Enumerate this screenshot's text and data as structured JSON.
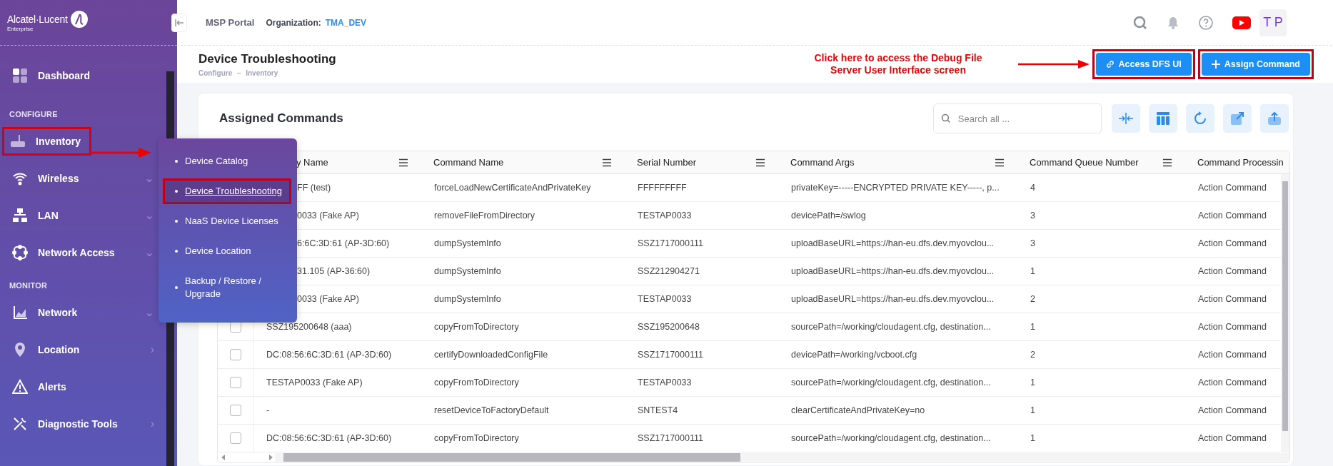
{
  "sidebar": {
    "brand": "Alcatel·Lucent",
    "brand_sub": "Enterprise",
    "items": [
      {
        "kind": "item",
        "label": "Dashboard",
        "highlighted": false
      },
      {
        "kind": "section",
        "label": "CONFIGURE"
      },
      {
        "kind": "item",
        "label": "Inventory",
        "highlighted": true
      },
      {
        "kind": "item",
        "label": "Wireless",
        "highlighted": false,
        "chevron": "⌄"
      },
      {
        "kind": "item",
        "label": "LAN",
        "highlighted": false,
        "chevron": "⌄"
      },
      {
        "kind": "item",
        "label": "Network Access",
        "highlighted": false,
        "chevron": "⌄"
      },
      {
        "kind": "section",
        "label": "MONITOR"
      },
      {
        "kind": "item",
        "label": "Network",
        "highlighted": false,
        "chevron": "⌄"
      },
      {
        "kind": "item",
        "label": "Location",
        "highlighted": false,
        "chevron": "›"
      },
      {
        "kind": "item",
        "label": "Alerts",
        "highlighted": false
      },
      {
        "kind": "item",
        "label": "Diagnostic Tools",
        "highlighted": false,
        "chevron": "›"
      }
    ]
  },
  "flyout": {
    "items": [
      {
        "label": "Device Catalog",
        "selected": false,
        "highlighted": false
      },
      {
        "label": "Device Troubleshooting",
        "selected": true,
        "highlighted": true
      },
      {
        "label": "NaaS Device Licenses",
        "selected": false,
        "highlighted": false
      },
      {
        "label": "Device Location",
        "selected": false,
        "highlighted": false
      },
      {
        "label": "Backup / Restore / Upgrade",
        "selected": false,
        "highlighted": false
      }
    ]
  },
  "topbar": {
    "portal": "MSP Portal",
    "org_label": "Organization:",
    "org_value": "TMA_DEV",
    "avatar": "T P"
  },
  "page": {
    "title": "Device Troubleshooting",
    "breadcrumb": [
      "Configure",
      "Inventory"
    ],
    "annotation": "Click here to access the Debug File Server User Interface screen",
    "buttons": [
      {
        "label": "Access DFS UI",
        "kind": "link",
        "highlighted": true
      },
      {
        "label": "Assign Command",
        "kind": "add",
        "highlighted": true
      }
    ]
  },
  "card": {
    "title": "Assigned Commands",
    "search": {
      "placeholder": "Search all ..."
    }
  },
  "table": {
    "columns": [
      "y Name",
      "Command Name",
      "Serial Number",
      "Command Args",
      "Command Queue Number",
      "Command Processin"
    ],
    "rows": [
      {
        "cells": [
          "FF (test)",
          "forceLoadNewCertificateAndPrivateKey",
          "FFFFFFFFF",
          "privateKey=-----ENCRYPTED PRIVATE KEY-----, p...",
          "4",
          "Action Command"
        ]
      },
      {
        "cells": [
          "0033 (Fake AP)",
          "removeFileFromDirectory",
          "TESTAP0033",
          "devicePath=/swlog",
          "3",
          "Action Command"
        ]
      },
      {
        "cells": [
          "6:6C:3D:61 (AP-3D:60)",
          "dumpSystemInfo",
          "SSZ1717000111",
          "uploadBaseURL=https://han-eu.dfs.dev.myovclou...",
          "3",
          "Action Command"
        ]
      },
      {
        "cells": [
          "31.105 (AP-36:60)",
          "dumpSystemInfo",
          "SSZ212904271",
          "uploadBaseURL=https://han-eu.dfs.dev.myovclou...",
          "1",
          "Action Command"
        ]
      },
      {
        "cells": [
          "0033 (Fake AP)",
          "dumpSystemInfo",
          "TESTAP0033",
          "uploadBaseURL=https://han-eu.dfs.dev.myovclou...",
          "2",
          "Action Command"
        ]
      },
      {
        "checked": false,
        "cells": [
          "SSZ195200648 (aaa)",
          "copyFromToDirectory",
          "SSZ195200648",
          "sourcePath=/working/cloudagent.cfg, destination...",
          "1",
          "Action Command"
        ]
      },
      {
        "checked": false,
        "cells": [
          "DC:08:56:6C:3D:61 (AP-3D:60)",
          "certifyDownloadedConfigFile",
          "SSZ1717000111",
          "devicePath=/working/vcboot.cfg",
          "2",
          "Action Command"
        ]
      },
      {
        "checked": false,
        "cells": [
          "TESTAP0033 (Fake AP)",
          "copyFromToDirectory",
          "TESTAP0033",
          "sourcePath=/working/cloudagent.cfg, destination...",
          "1",
          "Action Command"
        ]
      },
      {
        "checked": false,
        "cells": [
          "-",
          "resetDeviceToFactoryDefault",
          "SNTEST4",
          "clearCertificateAndPrivateKey=no",
          "1",
          "Action Command"
        ]
      },
      {
        "checked": false,
        "cells": [
          "DC:08:56:6C:3D:61 (AP-3D:60)",
          "copyFromToDirectory",
          "SSZ1717000111",
          "sourcePath=/working/cloudagent.cfg, destination...",
          "1",
          "Action Command"
        ]
      }
    ]
  }
}
